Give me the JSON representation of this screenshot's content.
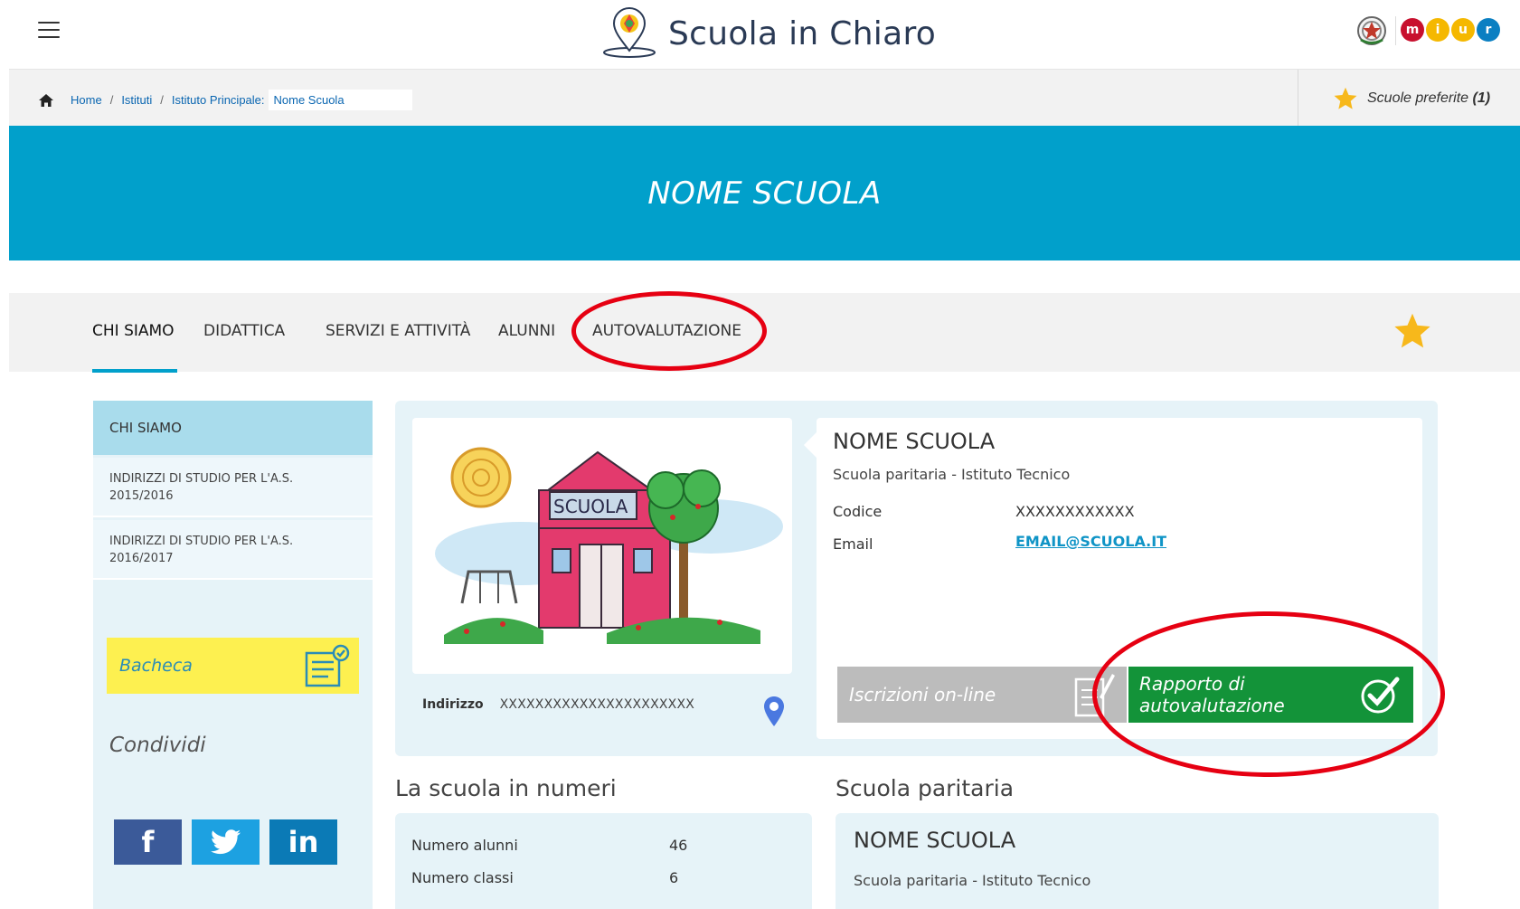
{
  "header": {
    "menu_icon": "hamburger-icon",
    "logo_text": "Scuola in Chiaro",
    "miur_letters": [
      "m",
      "i",
      "u",
      "r"
    ],
    "miur_colors": [
      "#c8102e",
      "#f5b800",
      "#f5b800",
      "#0a7fc2"
    ]
  },
  "breadcrumb": {
    "home": "Home",
    "istituti": "Istituti",
    "principale": "Istituto Principale:",
    "current": "Nome Scuola",
    "separator": "/"
  },
  "favorites": {
    "label": "Scuole preferite",
    "count": "(1)"
  },
  "hero": {
    "title": "NOME SCUOLA"
  },
  "tabs": [
    {
      "label": "CHI SIAMO",
      "active": true
    },
    {
      "label": "DIDATTICA"
    },
    {
      "label": "SERVIZI E ATTIVITÀ"
    },
    {
      "label": "ALUNNI"
    },
    {
      "label": "AUTOVALUTAZIONE"
    }
  ],
  "sidebar": {
    "header": "CHI SIAMO",
    "items": [
      {
        "line1": "INDIRIZZI DI STUDIO PER L'A.S.",
        "line2": "2015/2016"
      },
      {
        "line1": "INDIRIZZI DI STUDIO PER L'A.S.",
        "line2": "2016/2017"
      }
    ],
    "bacheca": "Bacheca",
    "condividi": "Condividi",
    "social": {
      "facebook": "f",
      "linkedin": "in"
    }
  },
  "school": {
    "name": "NOME SCUOLA",
    "type": "Scuola paritaria - Istituto Tecnico",
    "codice_label": "Codice",
    "codice_value": "XXXXXXXXXXXX",
    "email_label": "Email",
    "email_value": "EMAIL@SCUOLA.IT",
    "image_text": "SCUOLA",
    "address_label": "Indirizzo",
    "address_value": "XXXXXXXXXXXXXXXXXXXXXX"
  },
  "actions": {
    "iscrizioni": "Iscrizioni on-line",
    "rav_line1": "Rapporto di",
    "rav_line2": "autovalutazione"
  },
  "numbers": {
    "title": "La scuola in numeri",
    "rows": [
      {
        "label": "Numero alunni",
        "value": "46"
      },
      {
        "label": "Numero classi",
        "value": "6"
      }
    ]
  },
  "paritaria": {
    "title": "Scuola paritaria",
    "name": "NOME SCUOLA",
    "type": "Scuola paritaria - Istituto Tecnico"
  },
  "colors": {
    "accent": "#01a0cb",
    "star": "#f7b81b",
    "rav_green": "#139339",
    "iscrizioni_grey": "#bcbcbc",
    "bacheca_yellow": "#fdf050",
    "highlight_ring": "#e60012"
  }
}
